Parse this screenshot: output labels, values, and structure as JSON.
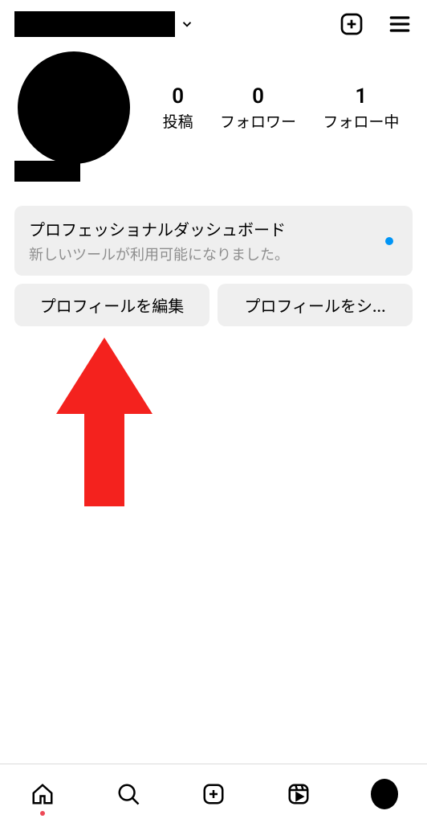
{
  "header": {
    "username_redacted": true
  },
  "stats": {
    "posts": {
      "count": "0",
      "label": "投稿"
    },
    "followers": {
      "count": "0",
      "label": "フォロワー"
    },
    "following": {
      "count": "1",
      "label": "フォロー中"
    }
  },
  "dashboard": {
    "title": "プロフェッショナルダッシュボード",
    "subtitle": "新しいツールが利用可能になりました。"
  },
  "actions": {
    "edit_profile": "プロフィールを編集",
    "share_profile": "プロフィールをシ..."
  }
}
